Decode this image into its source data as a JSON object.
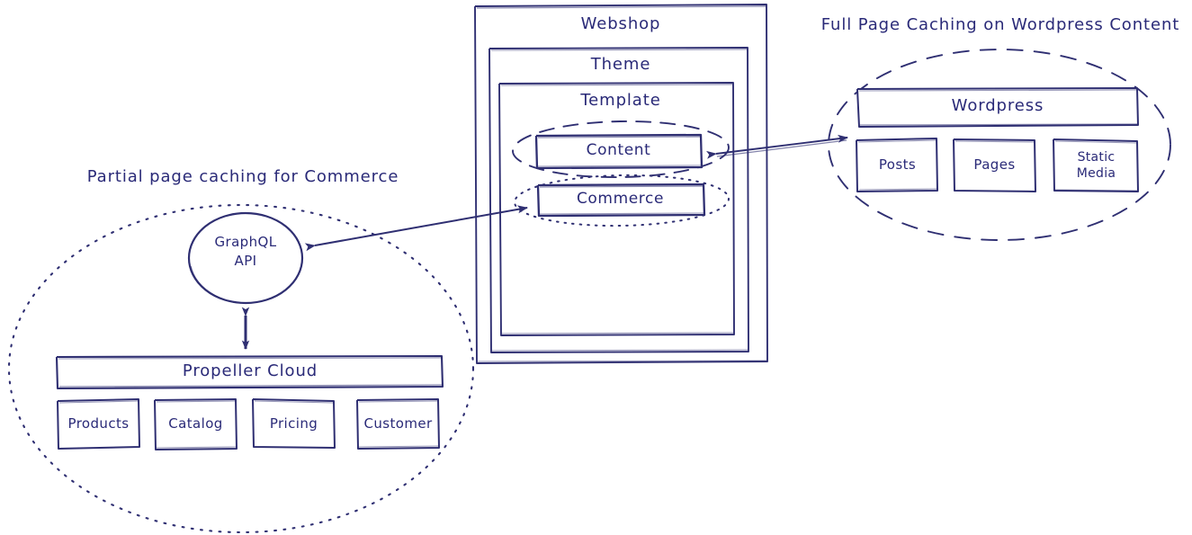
{
  "diagram": {
    "ink_color": "#2f2f72",
    "background": "#ffffff",
    "annotations": [
      {
        "id": "commerce-caching",
        "text": "Partial page caching for Commerce"
      },
      {
        "id": "wordpress-caching",
        "text": "Full Page Caching on Wordpress Content"
      }
    ]
  },
  "webshop": {
    "title": "Webshop",
    "theme": {
      "title": "Theme",
      "template": {
        "title": "Template",
        "blocks": [
          {
            "id": "content",
            "label": "Content"
          },
          {
            "id": "commerce",
            "label": "Commerce"
          }
        ]
      }
    }
  },
  "wordpress_group": {
    "caption": "Full Page Caching on Wordpress Content",
    "platform": "Wordpress",
    "items": [
      {
        "id": "posts",
        "label": "Posts"
      },
      {
        "id": "pages",
        "label": "Pages"
      },
      {
        "id": "static-media",
        "label": "Static\nMedia"
      }
    ]
  },
  "commerce_group": {
    "caption": "Partial page caching for Commerce",
    "api": "GraphQL\nAPI",
    "api_line_1": "GraphQL",
    "api_line_2": "API",
    "platform": "Propeller Cloud",
    "items": [
      {
        "id": "products",
        "label": "Products"
      },
      {
        "id": "catalog",
        "label": "Catalog"
      },
      {
        "id": "pricing",
        "label": "Pricing"
      },
      {
        "id": "customer",
        "label": "Customer"
      }
    ]
  },
  "connectors": [
    {
      "id": "content-wordpress",
      "from": "Content",
      "to": "Wordpress",
      "style": "double-arrow"
    },
    {
      "id": "commerce-graphql",
      "from": "Commerce",
      "to": "GraphQL API",
      "style": "double-arrow"
    },
    {
      "id": "graphql-propeller",
      "from": "GraphQL API",
      "to": "Propeller Cloud",
      "style": "double-arrow"
    }
  ]
}
